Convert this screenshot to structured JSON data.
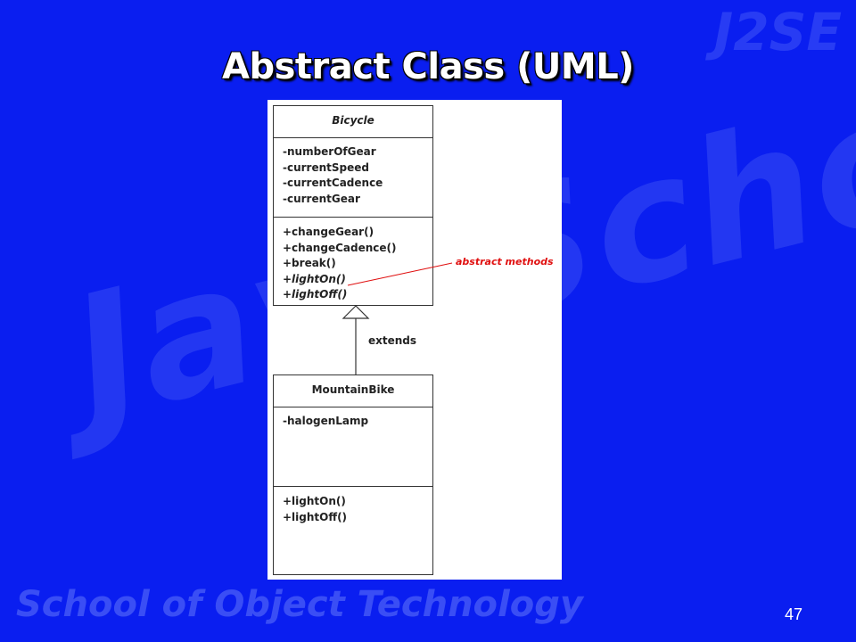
{
  "watermark": {
    "corner": "J2SE",
    "center": "JavaSchool",
    "footer": "School of Object Technology"
  },
  "slide": {
    "title": "Abstract Class (UML)",
    "page_number": "47"
  },
  "diagram": {
    "parent": {
      "name": "Bicycle",
      "attributes": [
        "-numberOfGear",
        "-currentSpeed",
        "-currentCadence",
        "-currentGear"
      ],
      "methods": [
        "+changeGear()",
        "+changeCadence()",
        "+break()",
        "+lightOn()",
        "+lightOff()"
      ],
      "abstract_methods": [
        "+lightOn()",
        "+lightOff()"
      ]
    },
    "child": {
      "name": "MountainBike",
      "attributes": [
        "-halogenLamp"
      ],
      "methods": [
        "+lightOn()",
        "+lightOff()"
      ]
    },
    "relationship_label": "extends",
    "annotation": "abstract methods",
    "colors": {
      "background": "#0a1ef0",
      "annotation": "#e01010"
    }
  }
}
